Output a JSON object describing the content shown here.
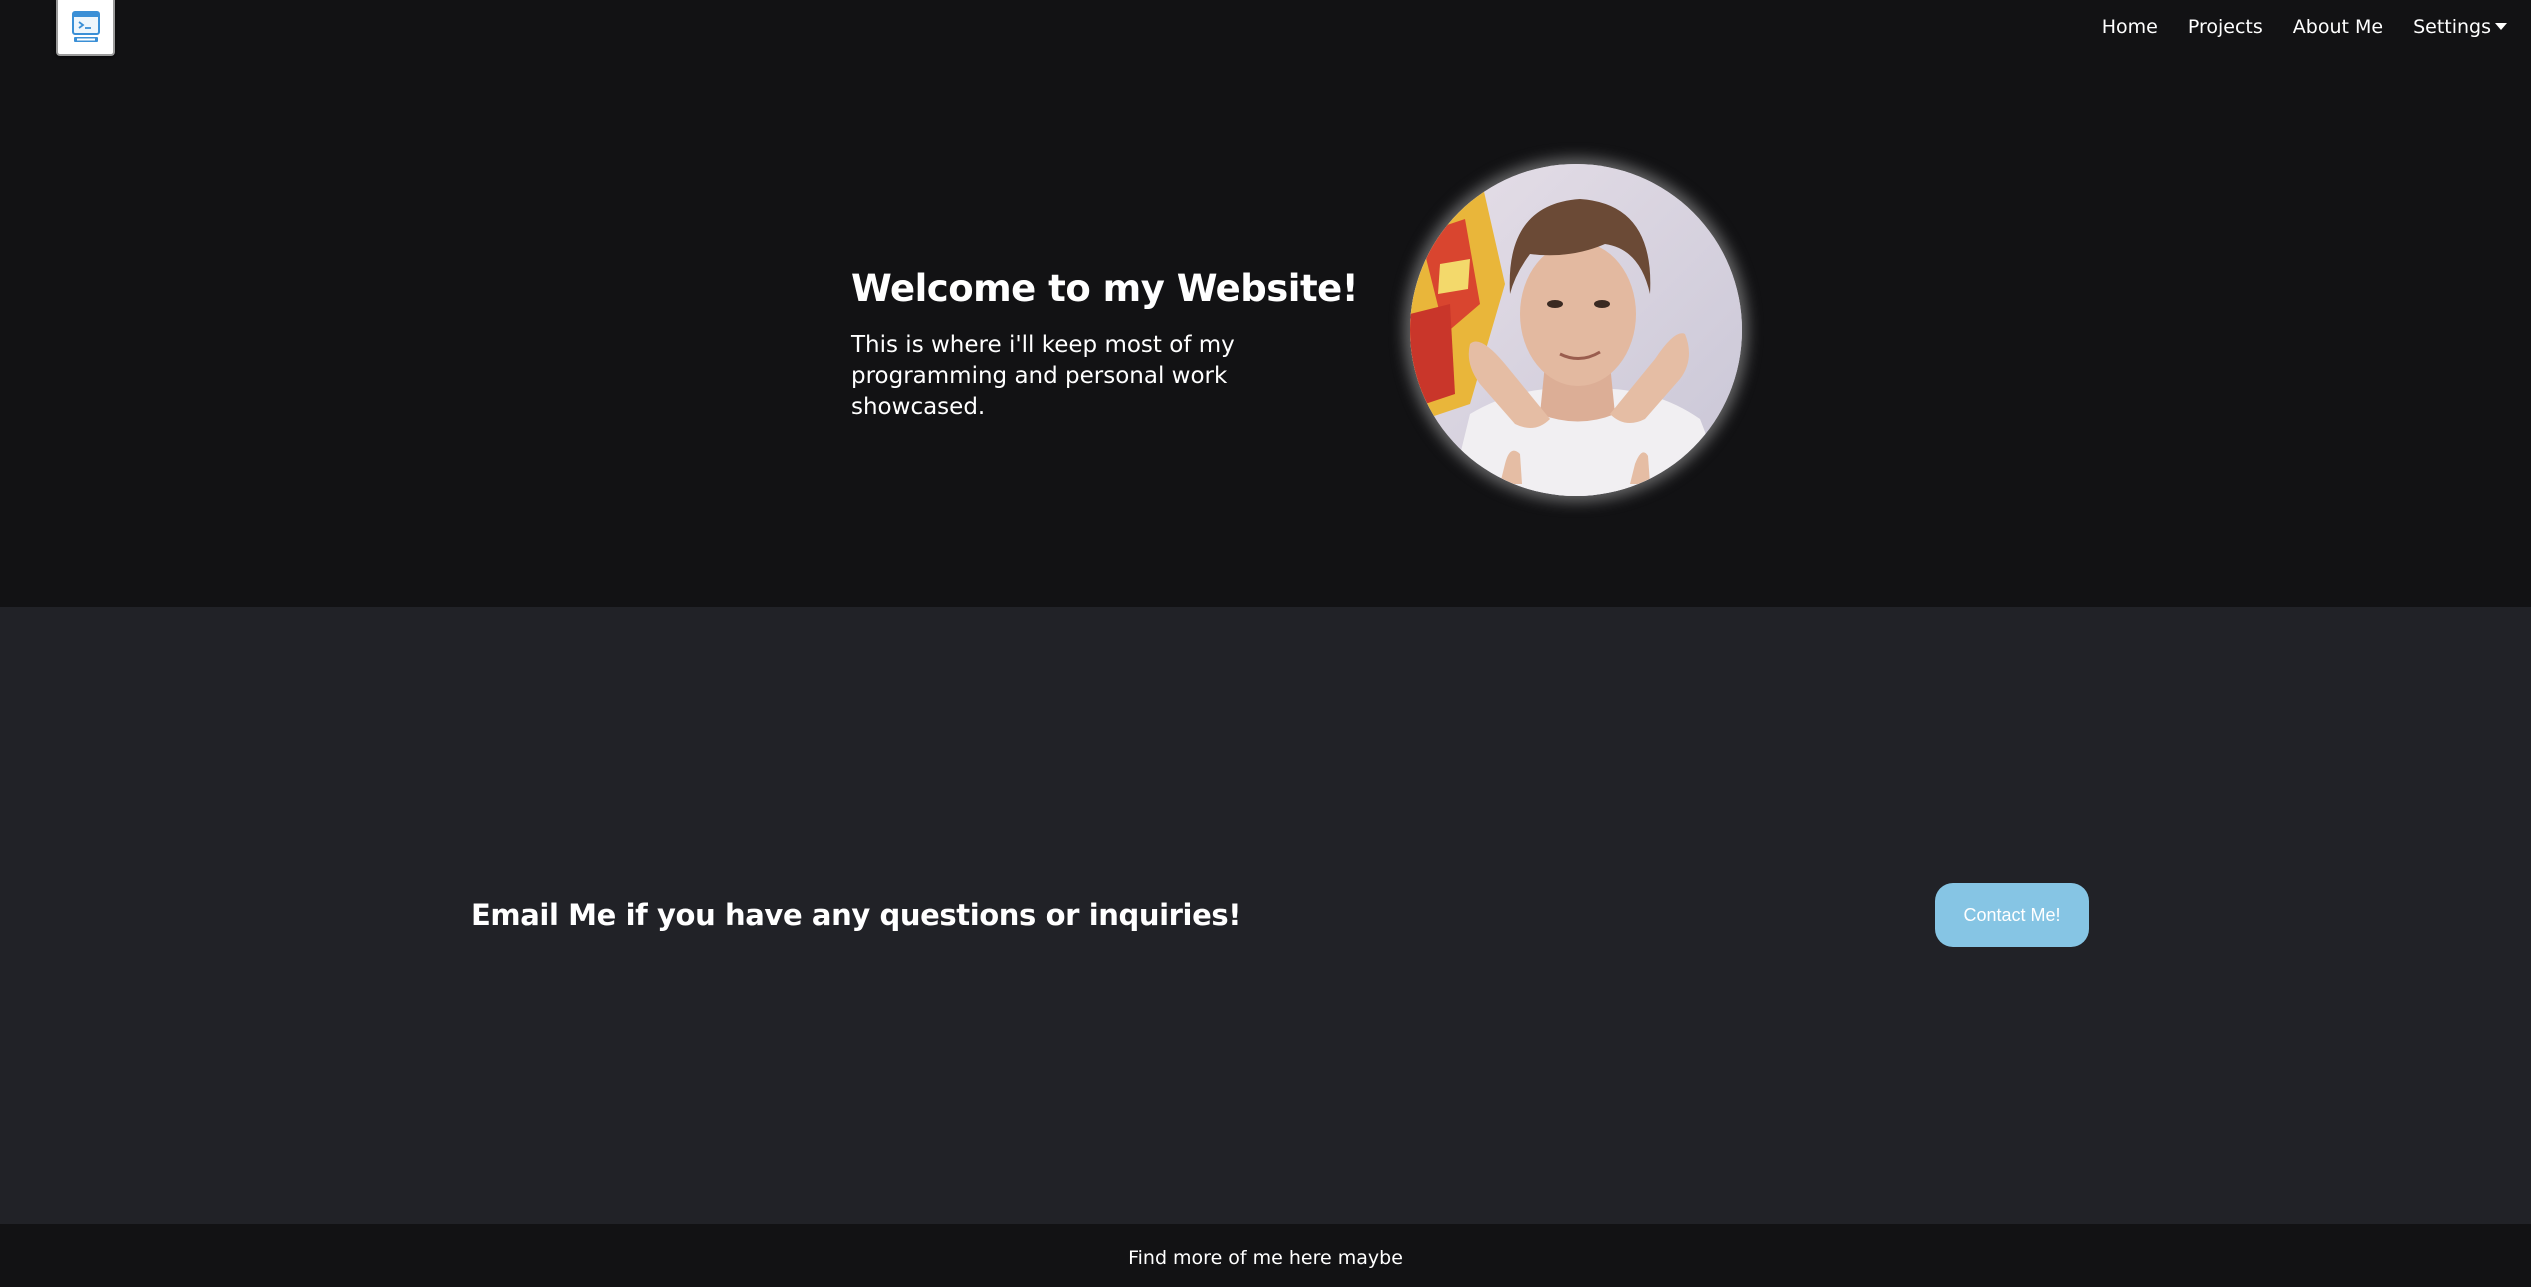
{
  "header": {
    "logo_icon": "terminal-window-icon",
    "nav": {
      "home": "Home",
      "projects": "Projects",
      "about": "About Me",
      "settings": "Settings"
    }
  },
  "hero": {
    "title": "Welcome to my Website!",
    "subtitle": "This is where i'll keep most of my programming and personal work showcased.",
    "avatar_icon": "profile-photo"
  },
  "contact": {
    "text": "Email Me if you have any questions or inquiries!",
    "button_label": "Contact Me!"
  },
  "footer": {
    "text": "Find more of me here maybe"
  },
  "colors": {
    "background": "#121214",
    "section_background": "#212227",
    "button": "#86c5e4",
    "text": "#ffffff"
  }
}
